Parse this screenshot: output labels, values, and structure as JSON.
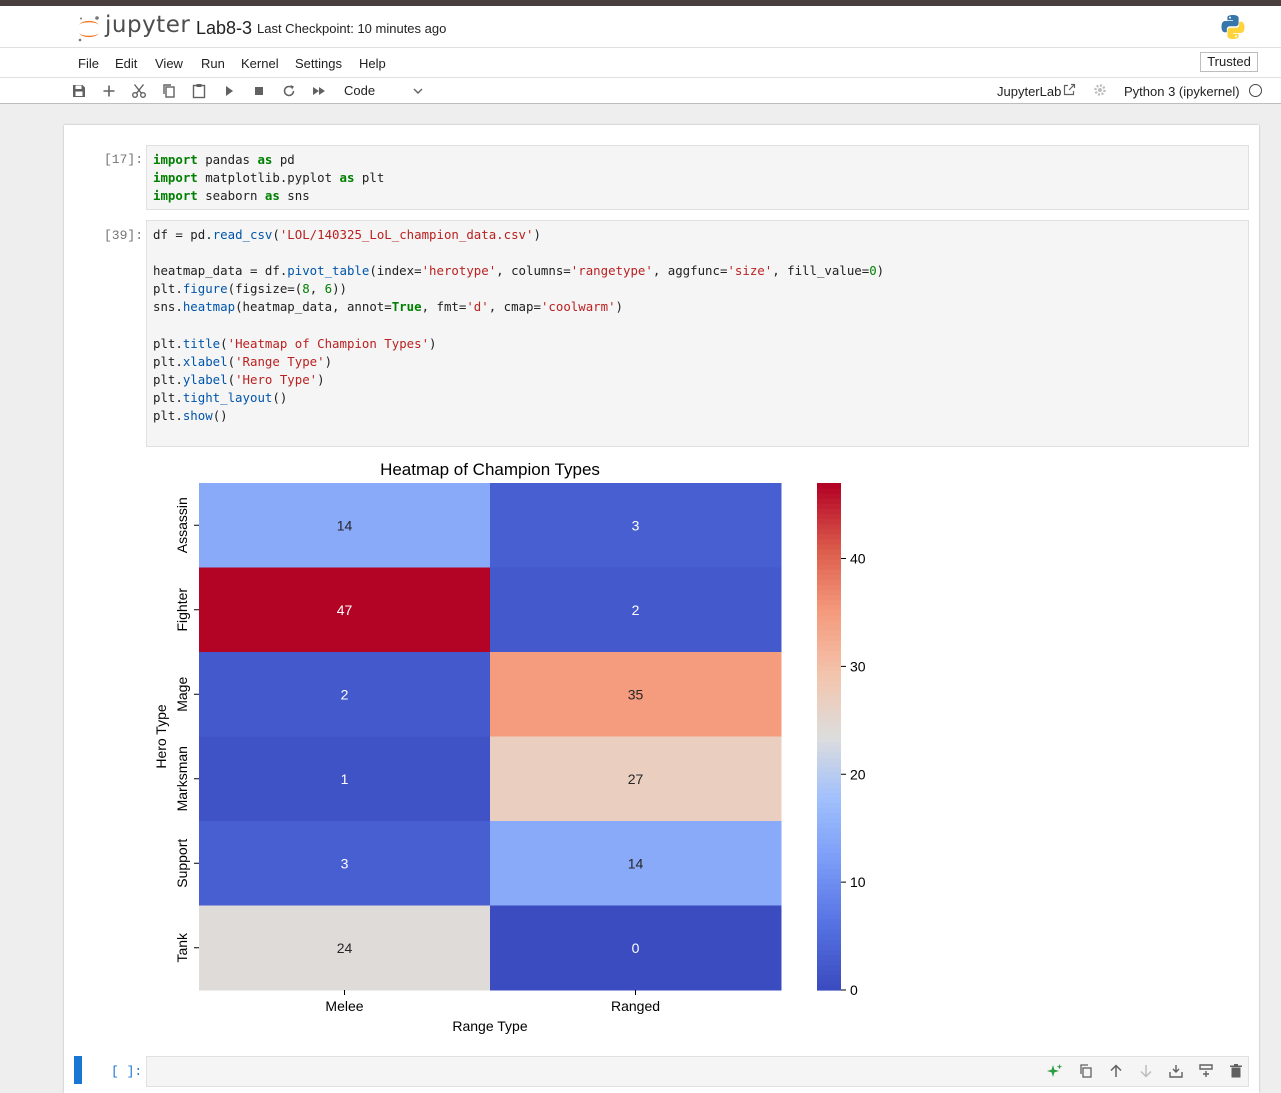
{
  "header": {
    "logo_text": "jupyter",
    "notebook_name": "Lab8-3",
    "checkpoint": "Last Checkpoint: 10 minutes ago"
  },
  "menu": [
    "File",
    "Edit",
    "View",
    "Run",
    "Kernel",
    "Settings",
    "Help"
  ],
  "trusted": "Trusted",
  "toolbar": {
    "cell_type": "Code",
    "jupyterlab_label": "JupyterLab",
    "kernel_label": "Python 3 (ipykernel)"
  },
  "cells": [
    {
      "prompt": "[17]:"
    },
    {
      "prompt": "[39]:"
    },
    {
      "prompt": "[ ]:"
    }
  ],
  "chart_data": {
    "type": "heatmap",
    "title": "Heatmap of Champion Types",
    "xlabel": "Range Type",
    "ylabel": "Hero Type",
    "x": [
      "Melee",
      "Ranged"
    ],
    "y": [
      "Assassin",
      "Fighter",
      "Mage",
      "Marksman",
      "Support",
      "Tank"
    ],
    "values": [
      [
        14,
        3
      ],
      [
        47,
        2
      ],
      [
        2,
        35
      ],
      [
        1,
        27
      ],
      [
        3,
        14
      ],
      [
        24,
        0
      ]
    ],
    "colorbar": {
      "range": [
        0,
        47
      ],
      "ticks": [
        0,
        10,
        20,
        30,
        40
      ]
    },
    "colormap": "coolwarm"
  }
}
